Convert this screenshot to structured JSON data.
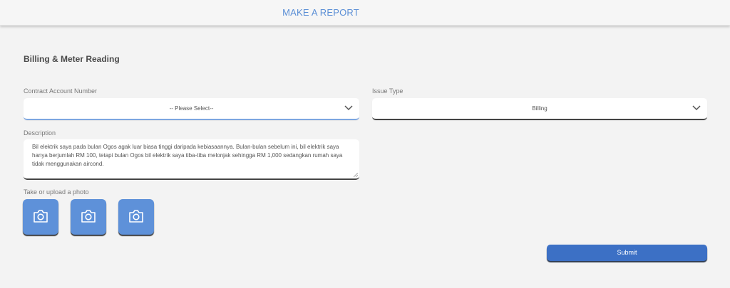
{
  "header": {
    "title": "MAKE A REPORT"
  },
  "section": {
    "title": "Billing & Meter Reading"
  },
  "contract": {
    "label": "Contract Account Number",
    "selected": "-- Please Select--"
  },
  "issue": {
    "label": "Issue Type",
    "selected": "Billing"
  },
  "description": {
    "label": "Description",
    "value": "Bil elektrik saya pada bulan Ogos agak luar biasa tinggi daripada kebiasaannya. Bulan-bulan sebelum ini, bil elektrik saya hanya berjumlah RM 100, tetapi bulan Ogos bil elektrik saya tiba-tiba melonjak sehingga RM 1,000 sedangkan rumah saya tidak menggunakan aircond."
  },
  "photos": {
    "label": "Take or upload a photo",
    "icon": "camera-icon",
    "count": 3
  },
  "submit": {
    "label": "Submit"
  },
  "colors": {
    "accent": "#5e91d9",
    "primary": "#3c70c5",
    "header_text": "#5b8fd6",
    "background": "#f3f3f3"
  }
}
